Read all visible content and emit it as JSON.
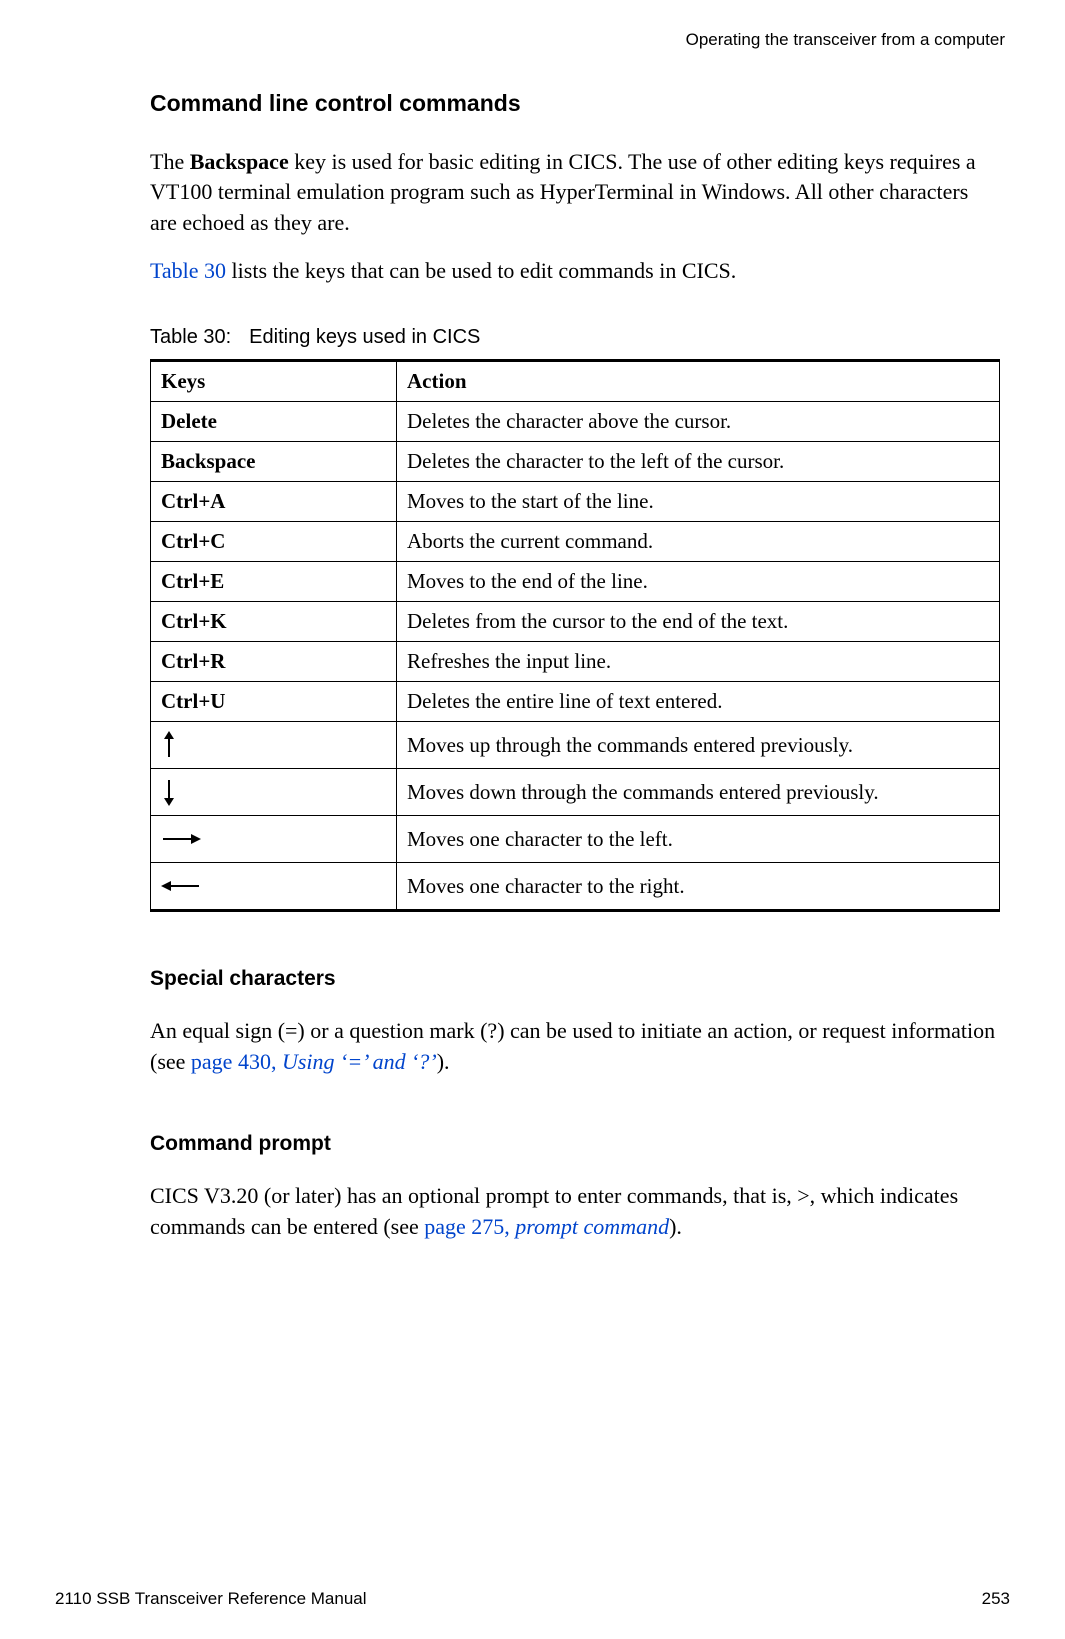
{
  "header": {
    "running": "Operating the transceiver from a computer"
  },
  "section1": {
    "title": "Command line control commands",
    "p1_a": "The ",
    "p1_bold": "Backspace",
    "p1_b": " key is used for basic editing in CICS. The use of other editing keys requires a VT100 terminal emulation program such as HyperTerminal in Windows. All other characters are echoed as they are.",
    "p2_link": "Table 30",
    "p2_b": " lists the keys that can be used to edit commands in CICS."
  },
  "table": {
    "caption_label": "Table 30:",
    "caption_title": "Editing keys used in CICS",
    "head_keys": "Keys",
    "head_action": "Action",
    "rows": [
      {
        "key": "Delete",
        "action": "Deletes the character above the cursor."
      },
      {
        "key": "Backspace",
        "action": "Deletes the character to the left of the cursor."
      },
      {
        "key": "Ctrl+A",
        "action": "Moves to the start of the line."
      },
      {
        "key": "Ctrl+C",
        "action": "Aborts the current command."
      },
      {
        "key": "Ctrl+E",
        "action": "Moves to the end of the line."
      },
      {
        "key": "Ctrl+K",
        "action": "Deletes from the cursor to the end of the text."
      },
      {
        "key": "Ctrl+R",
        "action": "Refreshes the input line."
      },
      {
        "key": "Ctrl+U",
        "action": "Deletes the entire line of text entered."
      },
      {
        "key": "arrow-up",
        "action": "Moves up through the commands entered previously."
      },
      {
        "key": "arrow-down",
        "action": "Moves down through the commands entered previously."
      },
      {
        "key": "arrow-right",
        "action": "Moves one character to the left."
      },
      {
        "key": "arrow-left",
        "action": "Moves one character to the right."
      }
    ]
  },
  "section2": {
    "title": "Special characters",
    "p_a": "An equal sign (=) or a question mark (?) can be used to initiate an action, or request information (see ",
    "p_link1": "page 430, ",
    "p_link2": "Using ‘=’ and ‘?’",
    "p_b": ")."
  },
  "section3": {
    "title": "Command prompt",
    "p_a": "CICS V3.20 (or later) has an optional prompt to enter commands, that is, >, which indicates commands can be entered (see ",
    "p_link1": "page 275, ",
    "p_link2": "prompt command",
    "p_b": ")."
  },
  "footer": {
    "left": "2110 SSB Transceiver Reference Manual",
    "right": "253"
  }
}
